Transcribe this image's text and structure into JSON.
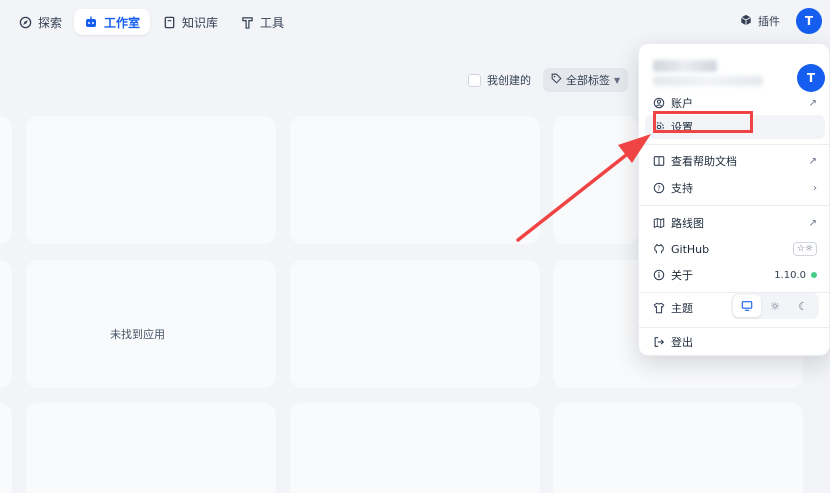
{
  "nav": {
    "items": [
      {
        "label": "探索",
        "icon": "compass-icon"
      },
      {
        "label": "工作室",
        "icon": "robot-icon"
      },
      {
        "label": "知识库",
        "icon": "book-icon"
      },
      {
        "label": "工具",
        "icon": "hammer-icon"
      }
    ],
    "plugin_label": "插件",
    "avatar_initial": "T"
  },
  "filters": {
    "created_by_me_label": "我创建的",
    "tags_label": "全部标签"
  },
  "main": {
    "empty_text": "未找到应用"
  },
  "menu": {
    "avatar_initial": "T",
    "items": {
      "account": "账户",
      "settings": "设置",
      "help_docs": "查看帮助文档",
      "support": "支持",
      "roadmap": "路线图",
      "github": "GitHub",
      "about": "关于",
      "version": "1.10.0",
      "theme": "主题",
      "logout": "登出"
    },
    "theme_options": [
      "system",
      "light",
      "dark"
    ],
    "theme_selected": "system"
  },
  "colors": {
    "accent": "#155eef",
    "annotation": "#f04444",
    "status_ok": "#47cd89"
  }
}
